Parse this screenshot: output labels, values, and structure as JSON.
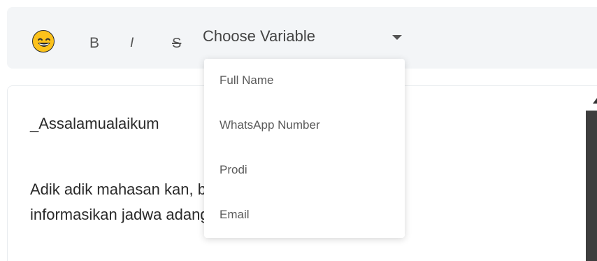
{
  "toolbar": {
    "emoji_icon": "grinning-face-emoji",
    "bold_label": "B",
    "italic_label": "I",
    "strike_label": "S",
    "variable_select": {
      "value": "Choose Variable",
      "icon": "caret-down-icon"
    }
  },
  "dropdown": {
    "items": [
      {
        "label": "Full Name"
      },
      {
        "label": "WhatsApp Number"
      },
      {
        "label": "Prodi"
      },
      {
        "label": "Email"
      }
    ]
  },
  "editor": {
    "line1": "_Assalamualaikum",
    "line2": "Adik adik mahasan                                 kan, berikut kami",
    "line3": "informasikan jadwa                                 adangsidimpuan."
  },
  "colors": {
    "toolbar_bg": "#f3f5f7",
    "emoji_yellow": "#fcc21b",
    "scrollbar": "#3e3e3e"
  }
}
